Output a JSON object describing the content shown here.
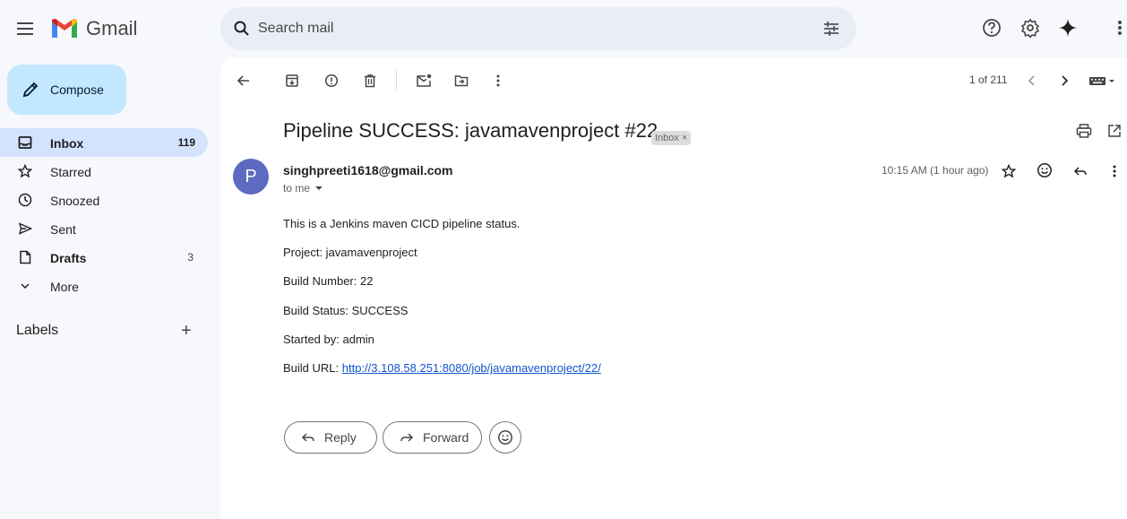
{
  "app": {
    "name": "Gmail"
  },
  "search": {
    "placeholder": "Search mail"
  },
  "sidebar": {
    "compose_label": "Compose",
    "items": [
      {
        "label": "Inbox",
        "count": "119",
        "active": true,
        "bold": true,
        "icon": "inbox-icon"
      },
      {
        "label": "Starred",
        "count": "",
        "icon": "star-icon"
      },
      {
        "label": "Snoozed",
        "count": "",
        "icon": "clock-icon"
      },
      {
        "label": "Sent",
        "count": "",
        "icon": "send-icon"
      },
      {
        "label": "Drafts",
        "count": "3",
        "bold": true,
        "icon": "draft-icon"
      },
      {
        "label": "More",
        "count": "",
        "icon": "chevron-down-icon"
      }
    ],
    "labels_heading": "Labels",
    "labels_add": "+"
  },
  "toolbar": {
    "pager": "1 of 211"
  },
  "email": {
    "subject": "Pipeline SUCCESS: javamavenproject #22",
    "chip": "Inbox ×",
    "avatar_letter": "P",
    "sender": "singhpreeti1618@gmail.com",
    "to": "to me",
    "time": "10:15 AM (1 hour ago)",
    "lines": [
      "This is a Jenkins maven CICD pipeline status.",
      "Project: javamavenproject",
      "Build Number: 22",
      "Build Status: SUCCESS",
      "Started by: admin"
    ],
    "url_label": "Build URL: ",
    "url": "http://3.108.58.251:8080/job/javamavenproject/22/"
  },
  "actions": {
    "reply": "Reply",
    "forward": "Forward"
  },
  "colors": {
    "accent": "#c2e7ff",
    "active_nav": "#d3e3fd",
    "avatar": "#5c6bc0",
    "link": "#1155cc"
  }
}
